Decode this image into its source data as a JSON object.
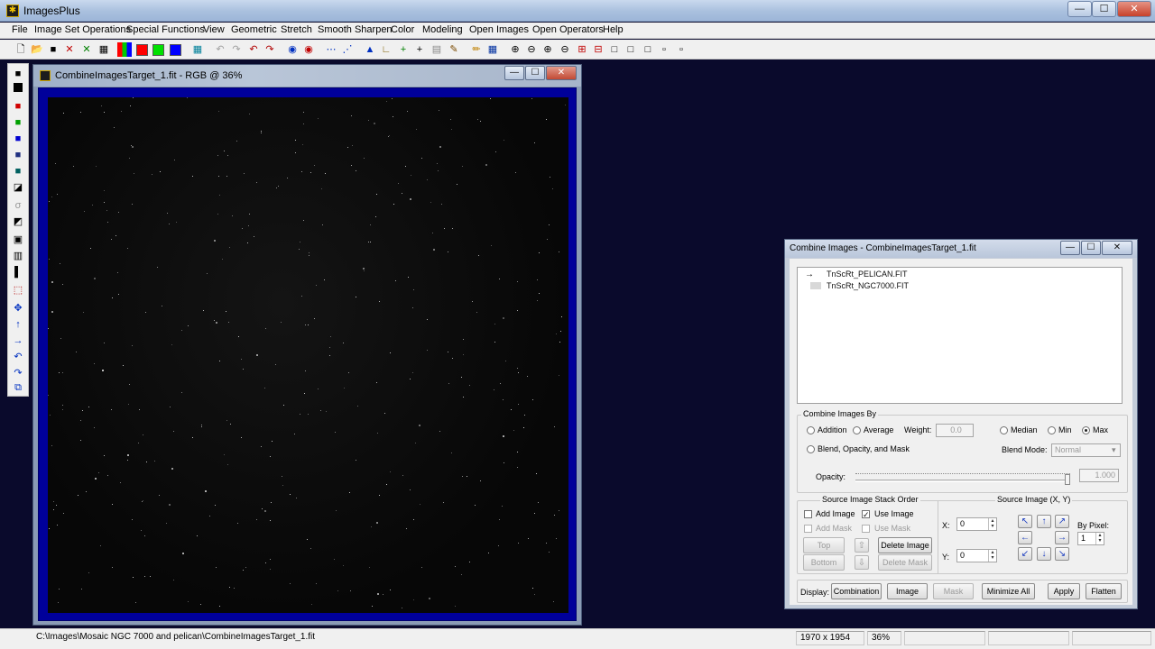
{
  "app": {
    "title": "ImagesPlus"
  },
  "window_controls": {
    "minimize": "—",
    "maximize": "☐",
    "close": "✕"
  },
  "menu": [
    "File",
    "Image Set Operations",
    "Special Functions",
    "View",
    "Geometric",
    "Stretch",
    "Smooth Sharpen",
    "Color",
    "Modeling",
    "Open Images",
    "Open Operators",
    "Help"
  ],
  "toolbar": {
    "icons": [
      "new-file-icon",
      "open-file-icon",
      "save-icon",
      "close-x-icon",
      "close-all-icon",
      "print-icon",
      "rgb-channels-icon",
      "red-channel-icon",
      "green-channel-icon",
      "blue-channel-icon",
      "grid-icon",
      "undo-icon",
      "redo-icon",
      "undo-all-icon",
      "redo-all-icon",
      "target-icon",
      "stop-icon",
      "dots-icon",
      "histogram-icon",
      "levels-icon",
      "crosshair-icon",
      "plus-icon",
      "table-icon",
      "palette-icon",
      "pencil-icon",
      "select-grid-icon",
      "zoom-in-icon",
      "zoom-out-icon",
      "zoom-fit-icon",
      "zoom-actual-icon",
      "add-icon",
      "minus-icon",
      "square-1-icon",
      "square-2-icon",
      "square-3-icon",
      "square-4-icon",
      "square-5-icon"
    ],
    "swatches": {
      "red": "#ff0000",
      "green": "#00e000",
      "blue": "#0000ff"
    }
  },
  "left_tools": [
    "save-tool-icon",
    "black-square-icon",
    "red-square-icon",
    "green-square-icon",
    "blue-square-icon",
    "mixed-square-icon",
    "cyan-square-icon",
    "half-square-icon",
    "brush-icon",
    "gradient-icon",
    "frame-icon",
    "bars-icon",
    "split-icon",
    "crop-icon",
    "move-icon",
    "arrow-up-icon",
    "arrow-right-icon",
    "rotate-left-icon",
    "rotate-right-icon",
    "copy-icon"
  ],
  "image_window": {
    "title": "CombineImagesTarget_1.fit - RGB @ 36%",
    "frame_color": "#00009a"
  },
  "status": {
    "path": "C:\\Images\\Mosaic NGC 7000 and pelican\\CombineImagesTarget_1.fit",
    "dimensions": "1970 x 1954",
    "zoom": "36%"
  },
  "combine_dialog": {
    "title": "Combine Images - CombineImagesTarget_1.fit",
    "images": [
      "TnScRt_PELICAN.FIT",
      "TnScRt_NGC7000.FIT"
    ],
    "combine_by": {
      "group_label": "Combine Images By",
      "addition": "Addition",
      "average": "Average",
      "weight_label": "Weight:",
      "weight_value": "0.0",
      "median": "Median",
      "min": "Min",
      "max": "Max",
      "selected": "Max",
      "blend_label": "Blend, Opacity, and Mask",
      "blend_mode_label": "Blend Mode:",
      "blend_mode_value": "Normal",
      "opacity_label": "Opacity:",
      "opacity_value": "1.000",
      "opacity_fraction": 1.0
    },
    "stack": {
      "group_label": "Source Image Stack Order",
      "add_image": "Add Image",
      "use_image": "Use Image",
      "use_image_checked": true,
      "add_mask": "Add Mask",
      "use_mask": "Use Mask",
      "top": "Top",
      "bottom": "Bottom",
      "delete_image": "Delete Image",
      "delete_mask": "Delete Mask"
    },
    "source_xy": {
      "group_label": "Source Image (X, Y)",
      "x_label": "X:",
      "x_value": "0",
      "y_label": "Y:",
      "y_value": "0",
      "by_pixel_label": "By Pixel:",
      "by_pixel_value": "1"
    },
    "display": {
      "label": "Display:",
      "combination": "Combination",
      "image": "Image",
      "mask": "Mask",
      "minimize_all": "Minimize All",
      "apply": "Apply",
      "flatten": "Flatten"
    }
  }
}
